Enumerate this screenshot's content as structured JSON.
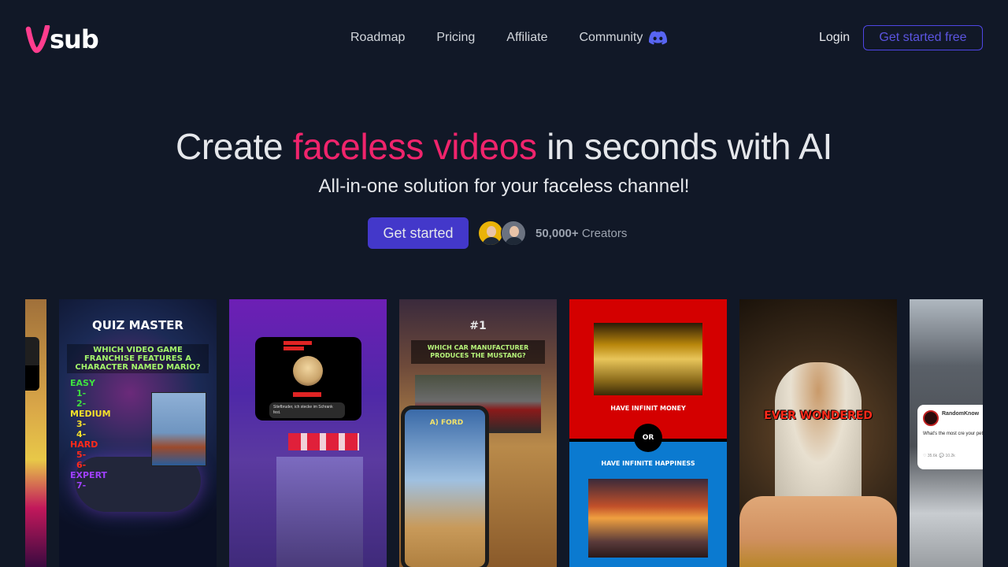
{
  "brand": {
    "logo_mark": "V",
    "logo_text": "sub",
    "accent_color": "#ff3d8e"
  },
  "nav": {
    "items": [
      {
        "label": "Roadmap"
      },
      {
        "label": "Pricing"
      },
      {
        "label": "Affiliate"
      },
      {
        "label": "Community",
        "icon": "discord-icon"
      }
    ],
    "login_label": "Login",
    "cta_label": "Get started free"
  },
  "hero": {
    "title_before": "Create ",
    "title_accent": "faceless videos",
    "title_after": " in seconds with AI",
    "subtitle": "All-in-one solution for your faceless channel!",
    "cta_label": "Get started",
    "creators_count": "50,000+",
    "creators_label": "Creators"
  },
  "colors": {
    "background": "#111827",
    "accent_pink": "#f0246c",
    "primary_indigo": "#4338ca",
    "discord": "#5865f2"
  },
  "videos": [
    {
      "type": "partial-game-clip"
    },
    {
      "type": "quiz",
      "title": "Quiz Master",
      "question": "Which video game franchise features a character named Mario?",
      "levels": [
        {
          "label": "EASY",
          "items": [
            "1-",
            "2-"
          ]
        },
        {
          "label": "MEDIUM",
          "items": [
            "3-",
            "4-"
          ]
        },
        {
          "label": "HARD",
          "items": [
            "5-",
            "6-"
          ]
        },
        {
          "label": "EXPERT",
          "items": [
            "7-"
          ]
        }
      ]
    },
    {
      "type": "chat-story",
      "message": "Stiefbruder, ich stecke im Schrank fest."
    },
    {
      "type": "quiz",
      "number": "#1",
      "question": "Which car manufacturer produces the Mustang?",
      "answer": "A) Ford"
    },
    {
      "type": "would-you-rather",
      "option_a": "Have infinit money",
      "separator": "OR",
      "option_b": "Have infinite happiness"
    },
    {
      "type": "story",
      "caption": "EVER WONDERED"
    },
    {
      "type": "reddit-story",
      "username": "RandomKnow",
      "post": "What's the most cre your pet has ever do",
      "likes": "35.6k",
      "comments": "10.2k"
    }
  ]
}
